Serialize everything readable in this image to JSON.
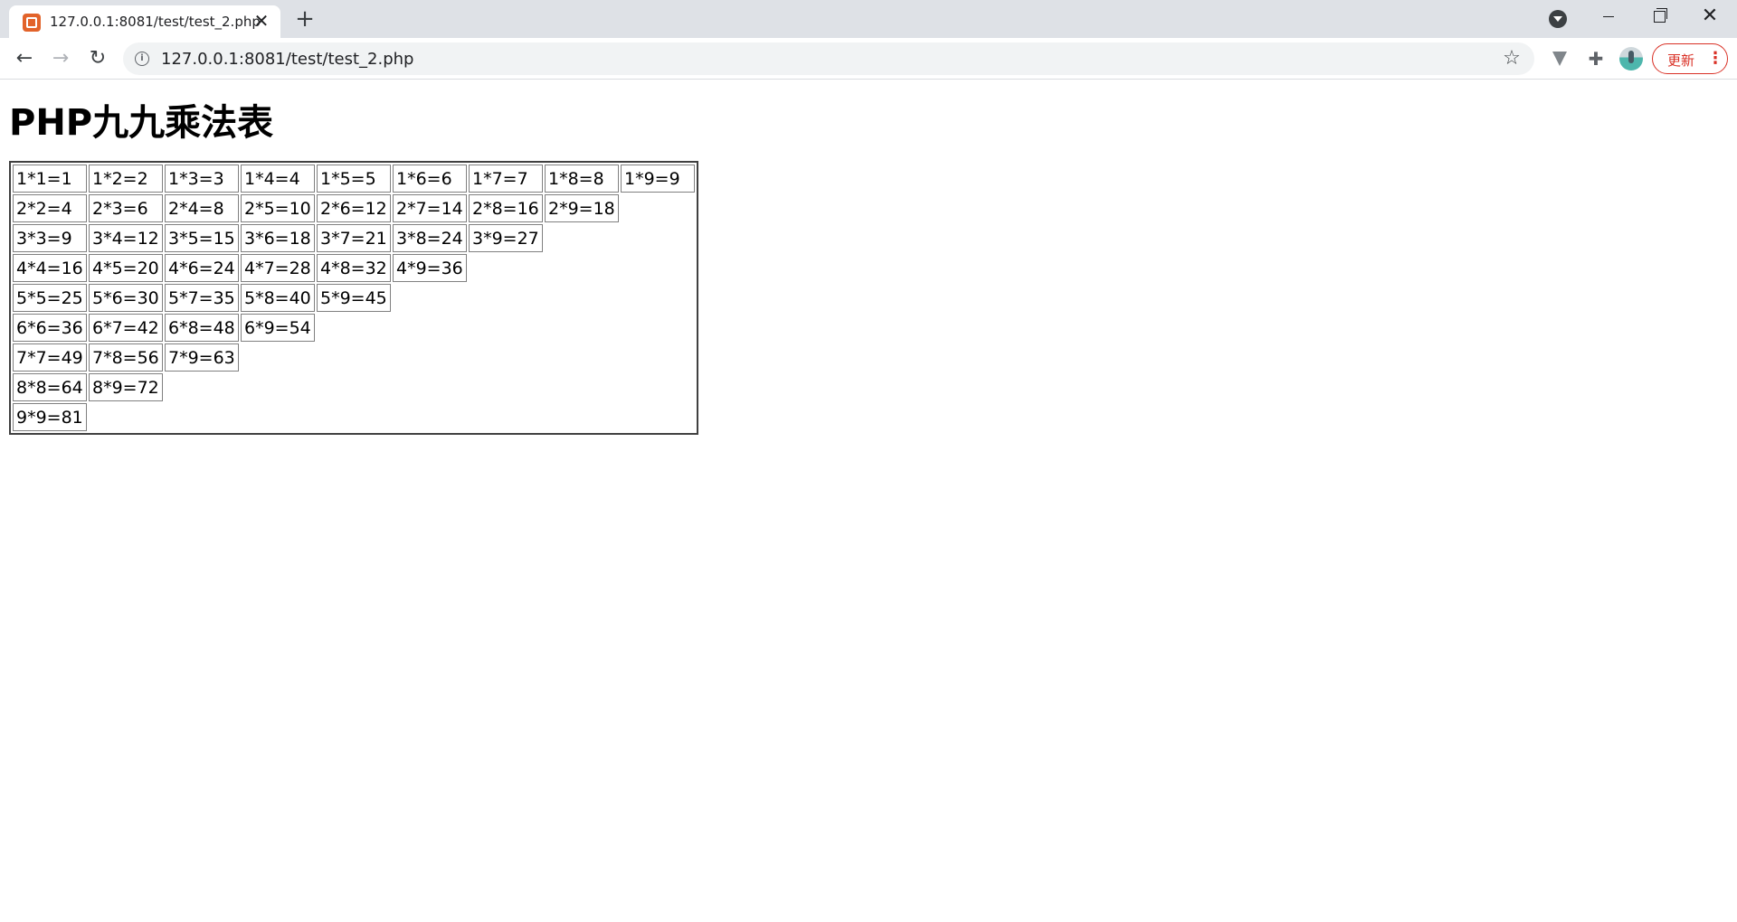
{
  "browser": {
    "tab": {
      "title": "127.0.0.1:8081/test/test_2.php",
      "close_glyph": "✕"
    },
    "new_tab_glyph": "+",
    "window_controls": {
      "close_glyph": "✕"
    },
    "toolbar": {
      "back_glyph": "←",
      "forward_glyph": "→",
      "reload_glyph": "↻",
      "info_glyph": "i",
      "url": "127.0.0.1:8081/test/test_2.php",
      "star_glyph": "☆",
      "puzzle_glyph": "✚",
      "update_label": "更新",
      "menu_glyph": "⋮"
    }
  },
  "page": {
    "title": "PHP九九乘法表",
    "table": [
      [
        "1*1=1",
        "1*2=2",
        "1*3=3",
        "1*4=4",
        "1*5=5",
        "1*6=6",
        "1*7=7",
        "1*8=8",
        "1*9=9"
      ],
      [
        "2*2=4",
        "2*3=6",
        "2*4=8",
        "2*5=10",
        "2*6=12",
        "2*7=14",
        "2*8=16",
        "2*9=18"
      ],
      [
        "3*3=9",
        "3*4=12",
        "3*5=15",
        "3*6=18",
        "3*7=21",
        "3*8=24",
        "3*9=27"
      ],
      [
        "4*4=16",
        "4*5=20",
        "4*6=24",
        "4*7=28",
        "4*8=32",
        "4*9=36"
      ],
      [
        "5*5=25",
        "5*6=30",
        "5*7=35",
        "5*8=40",
        "5*9=45"
      ],
      [
        "6*6=36",
        "6*7=42",
        "6*8=48",
        "6*9=54"
      ],
      [
        "7*7=49",
        "7*8=56",
        "7*9=63"
      ],
      [
        "8*8=64",
        "8*9=72"
      ],
      [
        "9*9=81"
      ]
    ]
  }
}
